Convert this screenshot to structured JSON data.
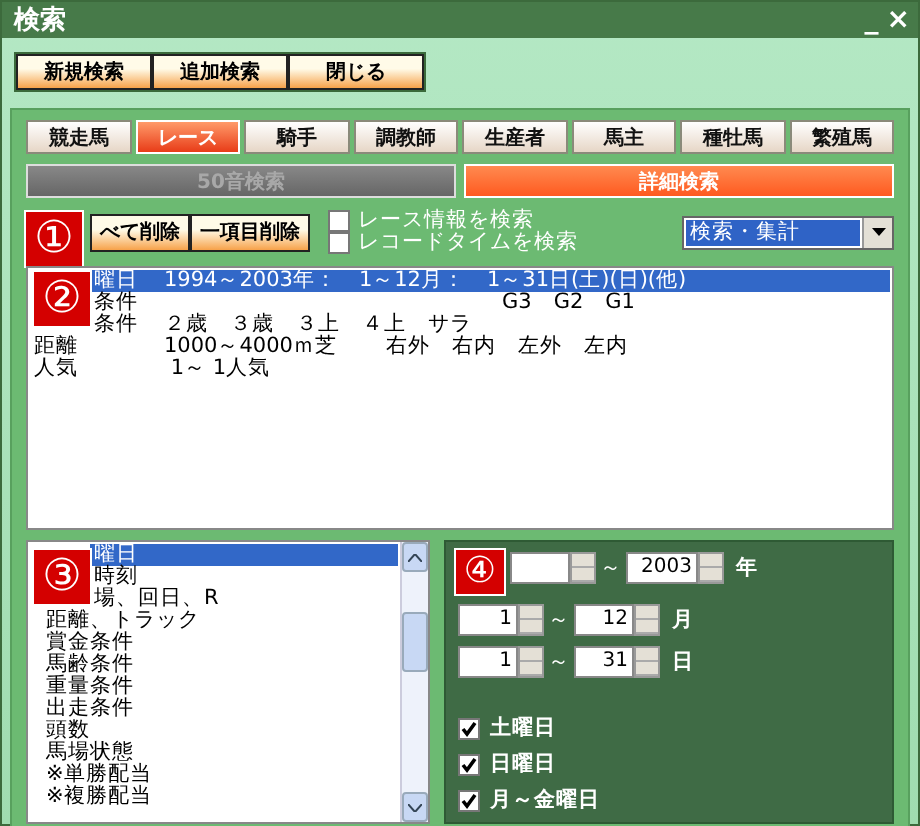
{
  "window": {
    "title": "検索",
    "minimize": "_",
    "close": "×"
  },
  "toolbar": [
    "新規検索",
    "追加検索",
    "閉じる"
  ],
  "tabs": [
    {
      "label": "競走馬",
      "selected": false
    },
    {
      "label": "レース",
      "selected": true
    },
    {
      "label": "騎手",
      "selected": false
    },
    {
      "label": "調教師",
      "selected": false
    },
    {
      "label": "生産者",
      "selected": false
    },
    {
      "label": "馬主",
      "selected": false
    },
    {
      "label": "種牡馬",
      "selected": false
    },
    {
      "label": "繁殖馬",
      "selected": false
    }
  ],
  "modes": [
    {
      "label": "50音検索",
      "selected": false,
      "disabled": true
    },
    {
      "label": "詳細検索",
      "selected": true,
      "disabled": false
    }
  ],
  "actions": [
    "べて削除",
    "一項目削除"
  ],
  "options": [
    {
      "label": "レース情報を検索",
      "checked": false
    },
    {
      "label": "レコードタイムを検索",
      "checked": false
    }
  ],
  "dropdown": {
    "value": "検索・集計"
  },
  "conditions": [
    {
      "label": "曜日",
      "covered": true,
      "selected": true,
      "column_2": "1994～2003年：　1～12月：　1～31日(土)(日)(他)"
    },
    {
      "label": "条件",
      "covered": true,
      "selected": false,
      "column_4": "G3　G2　G1"
    },
    {
      "label": "条件",
      "covered": true,
      "selected": false,
      "column_2": "２歳　３歳　３上　４上　サラ"
    },
    {
      "label": "距離",
      "covered": false,
      "selected": false,
      "column_2": "1000～4000ｍ芝",
      "column_3": "右外　右内　左外　左内"
    },
    {
      "label": "人気",
      "covered": false,
      "selected": false,
      "column_2": " 1～ 1人気"
    }
  ],
  "items": [
    {
      "label": "曜日",
      "covered": true,
      "selected": true
    },
    {
      "label": "時刻",
      "covered": true,
      "selected": false
    },
    {
      "label": "場、回日、R",
      "covered": true,
      "selected": false
    },
    {
      "label": "距離、トラック",
      "covered": false,
      "selected": false
    },
    {
      "label": "賞金条件",
      "covered": false,
      "selected": false
    },
    {
      "label": "馬齢条件",
      "covered": false,
      "selected": false
    },
    {
      "label": "重量条件",
      "covered": false,
      "selected": false
    },
    {
      "label": "出走条件",
      "covered": false,
      "selected": false
    },
    {
      "label": "頭数",
      "covered": false,
      "selected": false
    },
    {
      "label": "馬場状態",
      "covered": false,
      "selected": false
    },
    {
      "label": "※単勝配当",
      "covered": false,
      "selected": false
    },
    {
      "label": "※複勝配当",
      "covered": false,
      "selected": false
    }
  ],
  "ranges": [
    {
      "separator": "～",
      "to": "2003",
      "unit": "年"
    },
    {
      "from": "1",
      "separator": "～",
      "to": "12",
      "unit": "月"
    },
    {
      "from": "1",
      "separator": "～",
      "to": "31",
      "unit": "日"
    }
  ],
  "days": [
    {
      "label": "土曜日",
      "checked": true
    },
    {
      "label": "日曜日",
      "checked": true
    },
    {
      "label": "月～金曜日",
      "checked": true
    }
  ],
  "markers": [
    "①",
    "②",
    "③",
    "④"
  ]
}
